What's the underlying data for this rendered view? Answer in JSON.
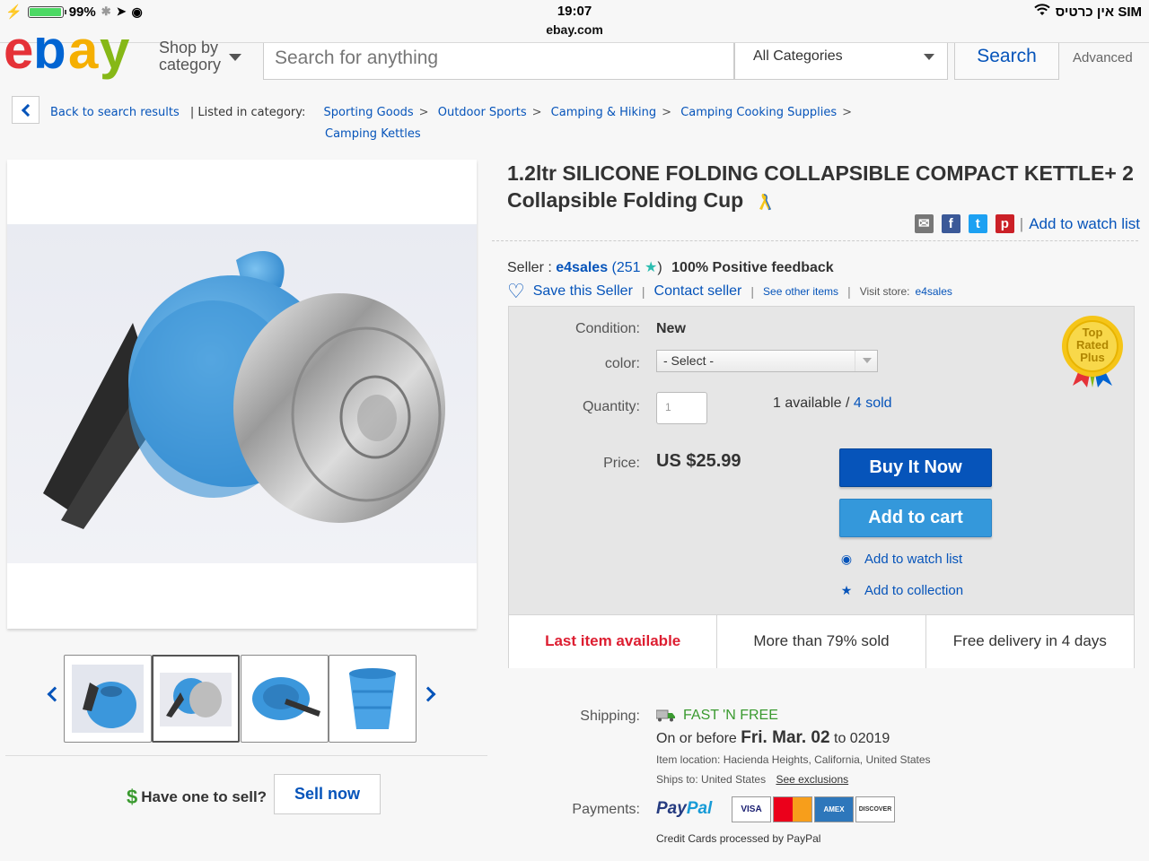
{
  "status_bar": {
    "battery": "99%",
    "time": "19:07",
    "url": "ebay.com",
    "carrier": "אין כרטיס SIM"
  },
  "header": {
    "logo": "ebay",
    "shop_by": "Shop by",
    "category": "category",
    "search_placeholder": "Search for anything",
    "category_select": "All Categories",
    "search_button": "Search",
    "advanced": "Advanced"
  },
  "breadcrumb": {
    "back": "Back to search results",
    "listed_in": "| Listed in category:",
    "items": [
      "Sporting Goods",
      "Outdoor Sports",
      "Camping & Hiking",
      "Camping Cooking Supplies",
      "Camping Kettles"
    ]
  },
  "item": {
    "title": "1.2ltr SILICONE FOLDING COLLAPSIBLE COMPACT KETTLE+ 2 Collapsible Folding Cup",
    "watch_link": "Add to watch list"
  },
  "seller": {
    "prefix": "Seller :",
    "name": "e4sales",
    "score": "251",
    "feedback": "100% Positive feedback",
    "save": "Save this Seller",
    "contact": "Contact seller",
    "see_other": "See other items",
    "visit_store": "Visit store:",
    "store": "e4sales"
  },
  "purchase": {
    "condition_label": "Condition:",
    "condition": "New",
    "color_label": "color:",
    "color_select": "- Select -",
    "quantity_label": "Quantity:",
    "quantity": "1",
    "available": "1 available /",
    "sold": "4 sold",
    "price_label": "Price:",
    "price": "US $25.99",
    "buy_now": "Buy It Now",
    "add_to_cart": "Add to cart",
    "add_watch": "Add to watch list",
    "add_collection": "Add to collection",
    "badge": [
      "Top",
      "Rated",
      "Plus"
    ]
  },
  "status_strip": [
    "Last item available",
    "More than 79% sold",
    "Free delivery in 4 days"
  ],
  "shipping": {
    "label": "Shipping:",
    "fast_free": "FAST 'N FREE",
    "on_or_before": "On or before",
    "date": "Fri. Mar. 02",
    "to": "to 02019",
    "item_location_label": "Item location:",
    "item_location": "Hacienda Heights, California, United States",
    "ships_to_label": "Ships to:",
    "ships_to": "United States",
    "exclusions": "See exclusions"
  },
  "payments": {
    "label": "Payments:",
    "paypal_pay": "Pay",
    "paypal_pal": "Pal",
    "cards": [
      "VISA",
      "MC",
      "AMEX",
      "DISCOVER"
    ],
    "note": "Credit Cards processed by PayPal"
  },
  "sell": {
    "dollar": "$",
    "question": "Have one to sell?",
    "button": "Sell now"
  },
  "colors": {
    "link": "#0654ba",
    "buy_now": "#0654ba",
    "add_to_cart": "#3498db",
    "last_item": "#dd1e31",
    "fast_free": "#3a9a2f"
  }
}
